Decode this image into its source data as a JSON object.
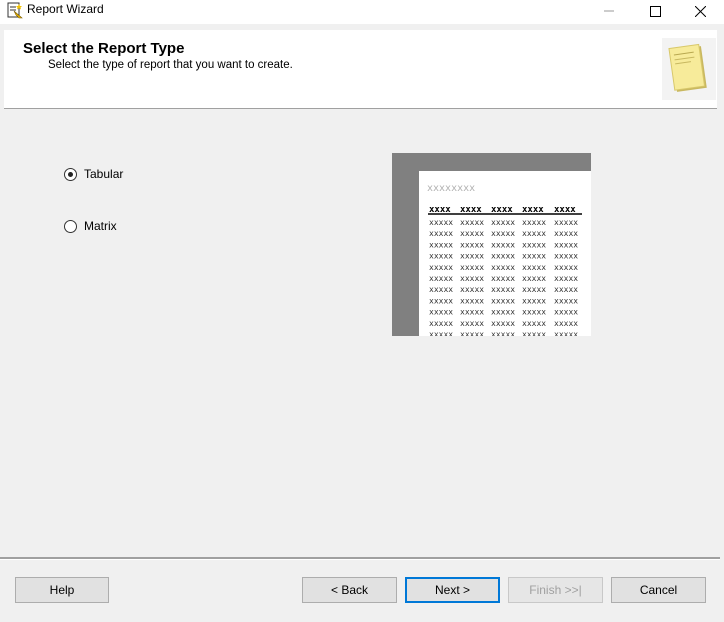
{
  "window": {
    "title": "Report Wizard",
    "icons": {
      "app": "report-wizard-icon",
      "minimize": "minimize-icon",
      "maximize": "maximize-icon",
      "close": "close-icon"
    }
  },
  "header": {
    "title": "Select the Report Type",
    "subtitle": "Select the type of report that you want to create.",
    "icon": "report-page-icon"
  },
  "report_types": [
    {
      "label": "Tabular",
      "selected": true
    },
    {
      "label": "Matrix",
      "selected": false
    }
  ],
  "preview": {
    "title_placeholder": "xxxxxxxx",
    "header_cells": [
      "xxxx",
      "xxxx",
      "xxxx",
      "xxxx",
      "xxxx"
    ],
    "cell_text": "xxxxx",
    "row_count": 11
  },
  "buttons": {
    "help": "Help",
    "back": "< Back",
    "next": "Next >",
    "finish": "Finish >>|",
    "cancel": "Cancel"
  }
}
